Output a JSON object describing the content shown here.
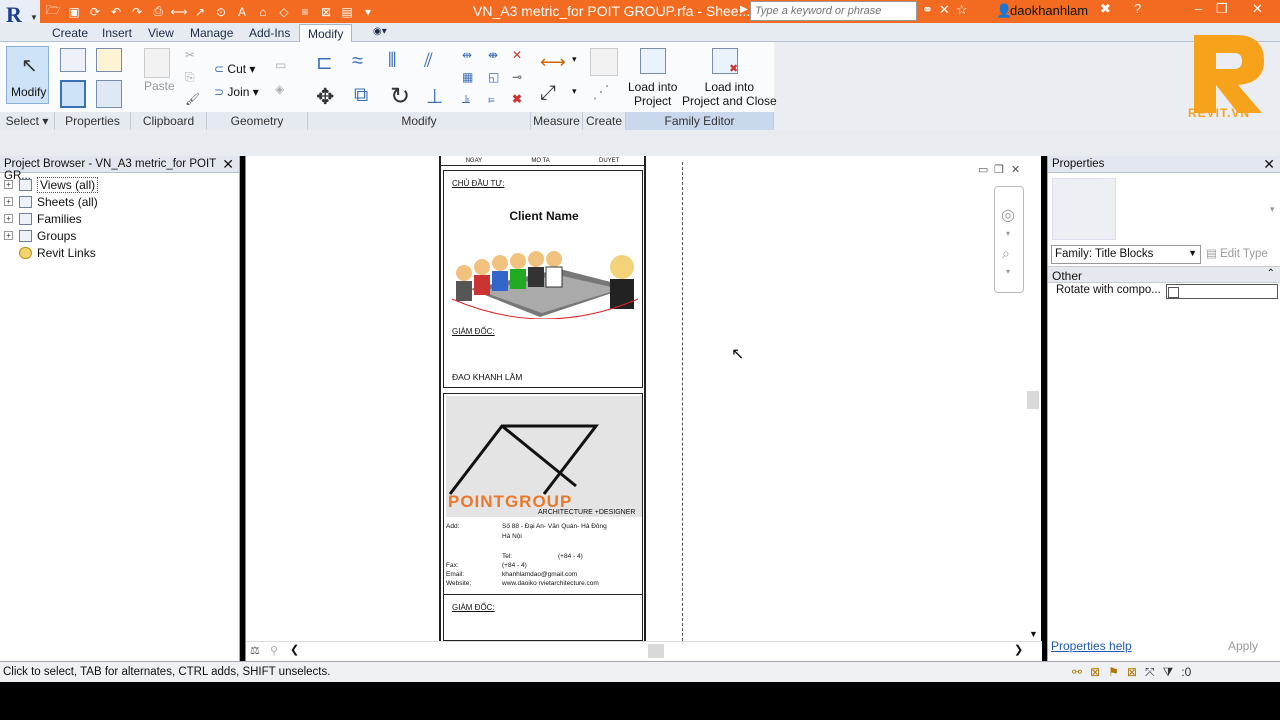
{
  "titlebar": {
    "document_title": "VN_A3 metric_for POIT GROUP.rfa - Shee...",
    "search_placeholder": "Type a keyword or phrase",
    "username": "daokhanhlam"
  },
  "tabs": [
    "Create",
    "Insert",
    "View",
    "Manage",
    "Add-Ins",
    "Modify"
  ],
  "active_tab": "Modify",
  "ribbon": {
    "modify_label": "Modify",
    "cut_label": "Cut",
    "join_label": "Join",
    "paste_label": "Paste",
    "load_into_project": "Load into\nProject",
    "load_into_project_close": "Load into\nProject and Close",
    "panels": {
      "select": "Select",
      "properties": "Properties",
      "clipboard": "Clipboard",
      "geometry": "Geometry",
      "modify": "Modify",
      "measure": "Measure",
      "create": "Create",
      "family_editor": "Family Editor"
    }
  },
  "watermark": {
    "brand": "REVIT.VN"
  },
  "project_browser": {
    "title": "Project Browser - VN_A3 metric_for POIT GR...",
    "items": [
      {
        "label": "Views (all)",
        "selected": true
      },
      {
        "label": "Sheets (all)"
      },
      {
        "label": "Families"
      },
      {
        "label": "Groups"
      },
      {
        "label": "Revit Links"
      }
    ]
  },
  "sheet": {
    "header_cols": [
      "NGAY",
      "MO TA",
      "DUYET"
    ],
    "owner_label": "CHỦ ĐẦU TƯ:",
    "client_name": "Client Name",
    "director_label": "GIÁM ĐỐC:",
    "director_name": "ĐAO KHANH LÂM",
    "company_logo_text": "POINTGROUP",
    "company_tagline": "ARCHITECTURE +DESIGNER",
    "address_label": "Add:",
    "address_value": "Số 88 - Đại An- Văn Quán- Hà Đông",
    "address_city": "Hà Nội",
    "tel_label": "Tel:",
    "tel_value": "(+84 - 4)",
    "fax_label": "Fax:",
    "fax_value": "(+84 - 4)",
    "email_label": "Email:",
    "email_value": "khanhlamdao@gmail.com",
    "website_label": "Website:",
    "website_value": "www.daoiko rvietarchitecture.com",
    "director2_label": "GIÁM ĐỐC:"
  },
  "properties": {
    "title": "Properties",
    "family_select": "Family: Title Blocks",
    "edit_type": "Edit Type",
    "group": "Other",
    "rows": [
      {
        "label": "Rotate with compo...",
        "checked": false
      }
    ],
    "help_link": "Properties help",
    "apply": "Apply"
  },
  "status": {
    "text": "Click to select, TAB for alternates, CTRL adds, SHIFT unselects.",
    "filter_count": ":0"
  },
  "colors": {
    "titlebar": "#f26b21",
    "ribbon_bg": "#fafbfd",
    "link_blue": "#1f59b5"
  }
}
